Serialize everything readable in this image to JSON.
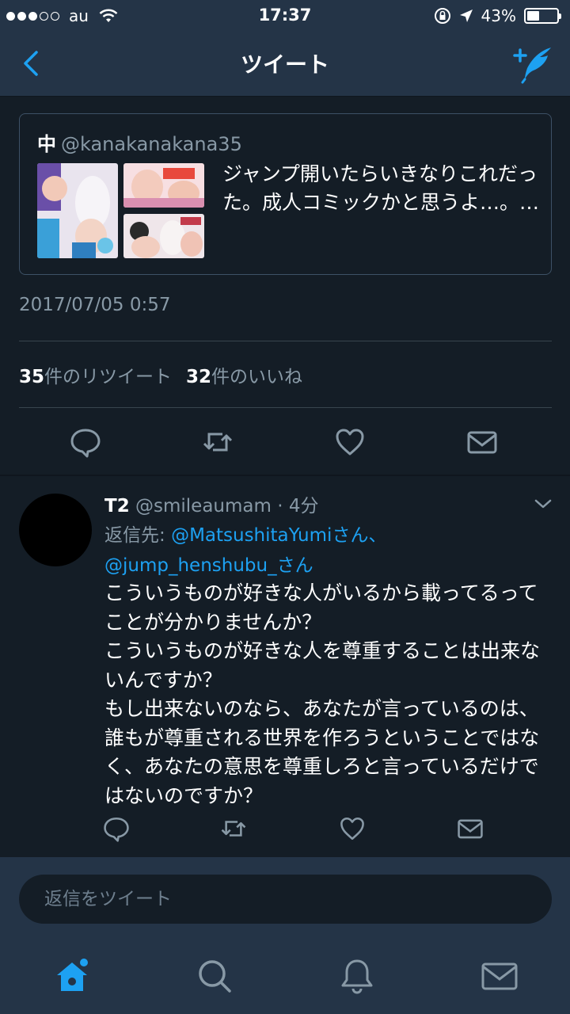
{
  "status": {
    "carrier": "au",
    "time": "17:37",
    "battery_percent": "43%",
    "battery_level": 0.43,
    "signal_bars_filled": 3,
    "signal_bars_total": 5
  },
  "nav": {
    "title": "ツイート"
  },
  "quote": {
    "name": "中",
    "handle": "@kanakanakana35",
    "text": "ジャンプ開いたらいきなりこれだった。成人コミックかと思うよ…。…"
  },
  "tweet": {
    "timestamp": "2017/07/05 0:57",
    "retweet_count": "35",
    "retweet_label": "件のリツイート",
    "like_count": "32",
    "like_label": "件のいいね"
  },
  "reply": {
    "name": "T2",
    "handle": "@smileaumam",
    "time": " · 4分",
    "replying_label": "返信先: ",
    "mention1": "@MatsushitaYumi",
    "mention1_suffix": "さん、",
    "mention2": "@jump_henshubu_",
    "mention2_suffix": "さん",
    "body": "こういうものが好きな人がいるから載ってるってことが分かりませんか？\nこういうものが好きな人を尊重することは出来ないんですか？\nもし出来ないのなら、あなたが言っているのは、誰もが尊重される世界を作ろうということではなく、あなたの意思を尊重しろと言っているだけではないのですか？"
  },
  "composer": {
    "placeholder": "返信をツイート"
  },
  "colors": {
    "accent": "#1da1f2",
    "background": "#141d26",
    "bar": "#243447",
    "muted": "#8899a6"
  },
  "icons": {
    "nav": [
      "back-icon",
      "compose-icon"
    ],
    "actions": [
      "reply-icon",
      "retweet-icon",
      "like-icon",
      "dm-icon"
    ],
    "tabs": [
      "home-icon",
      "search-icon",
      "notifications-icon",
      "messages-icon"
    ]
  }
}
